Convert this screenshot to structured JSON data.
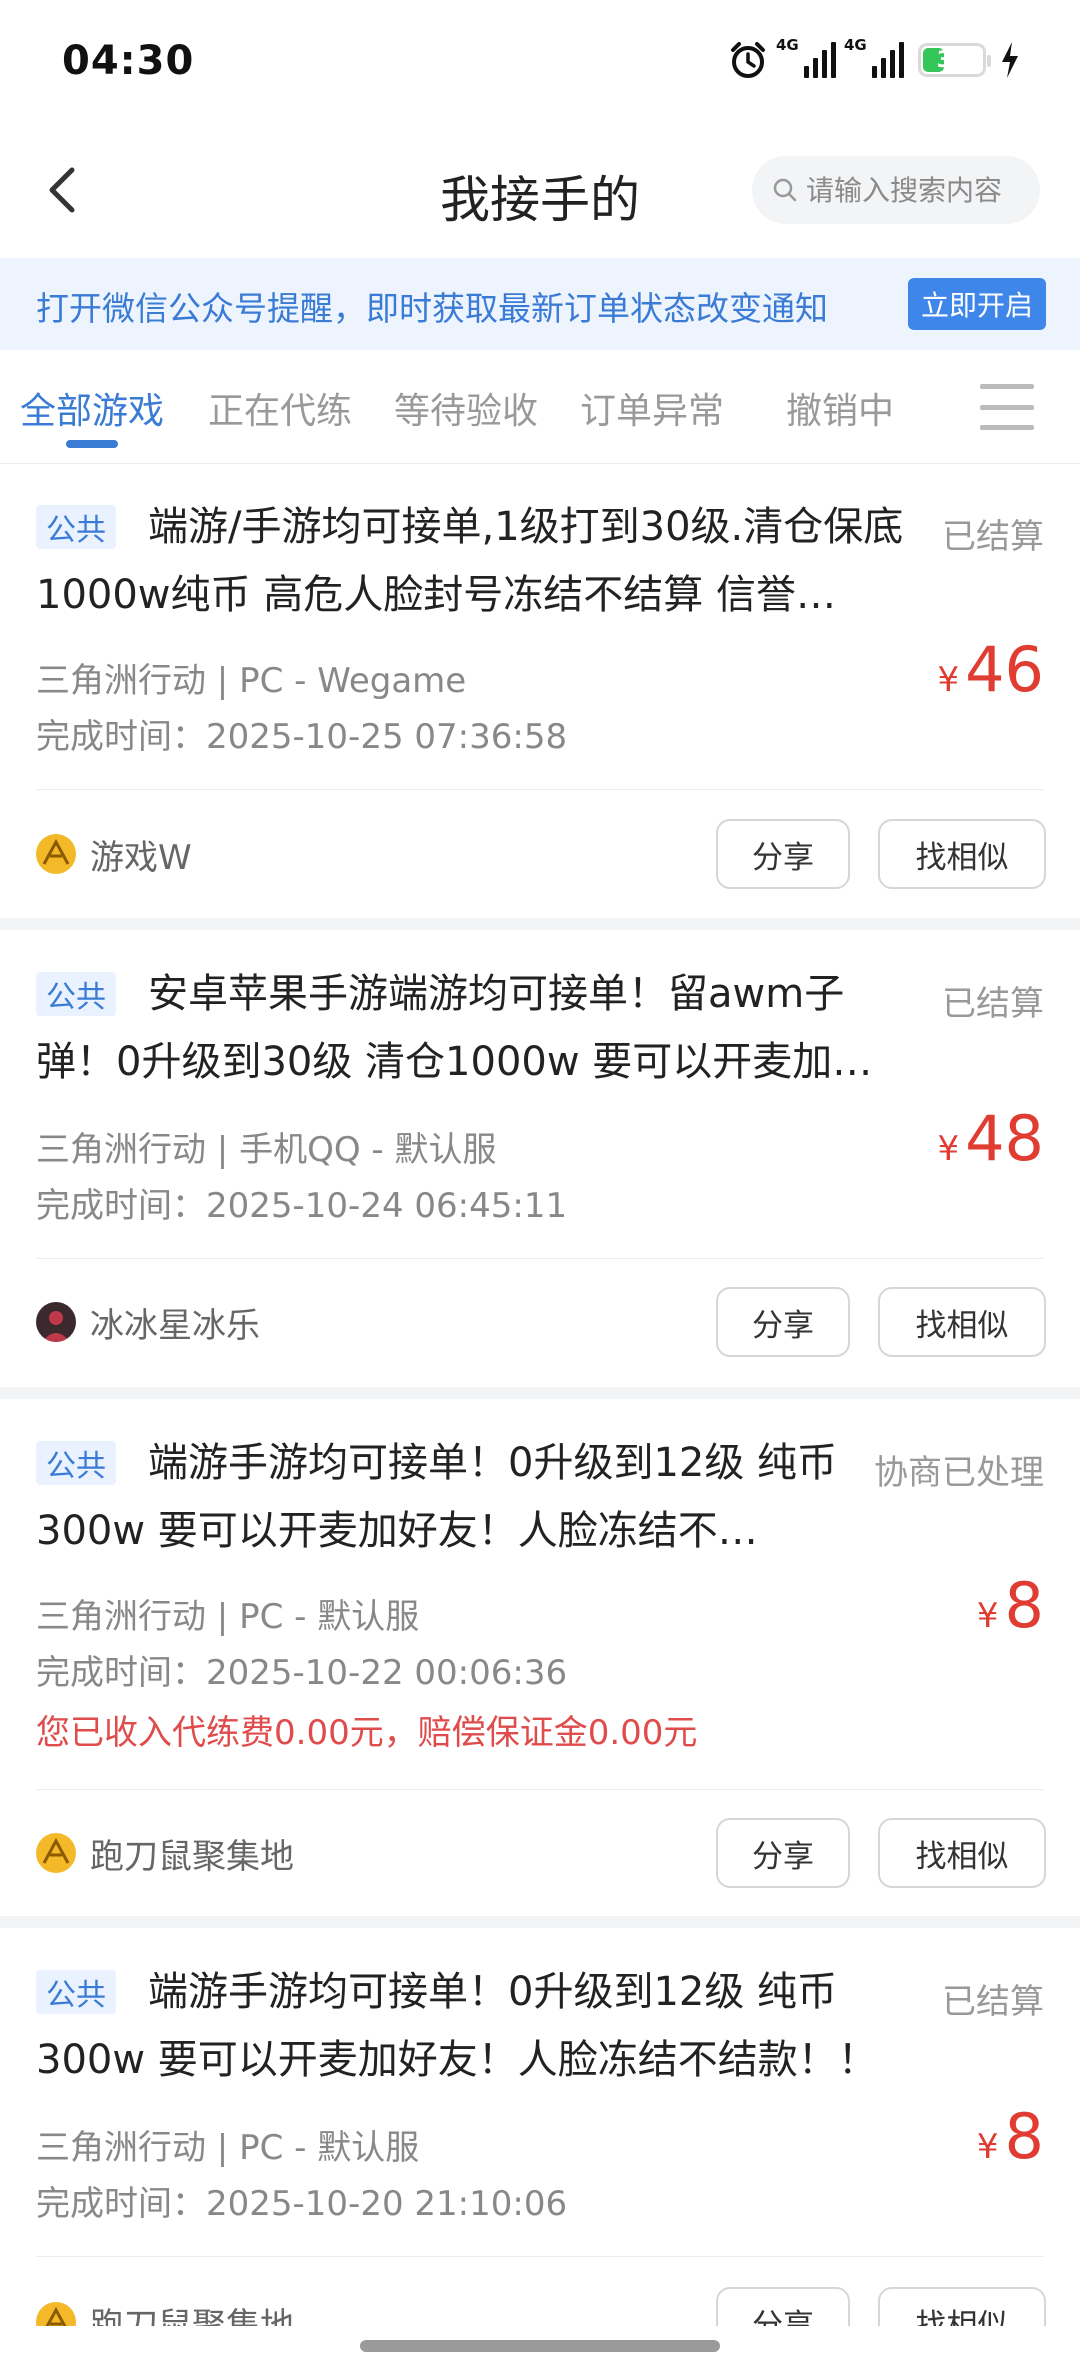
{
  "status_bar": {
    "time": "04:30",
    "signal_1_label": "4G",
    "signal_2_label": "4G",
    "battery": "34",
    "battery_level": 0.34,
    "icons": [
      "alarm-icon",
      "signal-icon",
      "signal-icon",
      "battery-icon",
      "charging-icon"
    ]
  },
  "header": {
    "title": "我接手的",
    "search_placeholder": "请输入搜索内容"
  },
  "banner": {
    "text": "打开微信公众号提醒，即时获取最新订单状态改变通知",
    "button": "立即开启"
  },
  "tabs": [
    {
      "label": "全部游戏",
      "active": true
    },
    {
      "label": "正在代练",
      "active": false
    },
    {
      "label": "等待验收",
      "active": false
    },
    {
      "label": "订单异常",
      "active": false
    },
    {
      "label": "撤销中",
      "active": false
    }
  ],
  "orders": [
    {
      "tag": "公共",
      "title": "端游/手游均可接单,1级打到30级.清仓保底1000w纯币 高危人脸封号冻结不结算 信誉…",
      "status": "已结算",
      "game": "三角洲行动 | PC - Wegame",
      "finish_time": "完成时间：2025-10-25 07:36:58",
      "currency": "¥",
      "price": "46",
      "user": "游戏W",
      "share": "分享",
      "similar": "找相似"
    },
    {
      "tag": "公共",
      "title": "安卓苹果手游端游均可接单！留awm子弹！0升级到30级 清仓1000w 要可以开麦加…",
      "status": "已结算",
      "game": "三角洲行动 | 手机QQ - 默认服",
      "finish_time": "完成时间：2025-10-24 06:45:11",
      "currency": "¥",
      "price": "48",
      "user": "冰冰星冰乐",
      "share": "分享",
      "similar": "找相似"
    },
    {
      "tag": "公共",
      "title": "端游手游均可接单！0升级到12级 纯币300w 要可以开麦加好友！人脸冻结不…",
      "status": "协商已处理",
      "game": "三角洲行动 | PC - 默认服",
      "finish_time": "完成时间：2025-10-22 00:06:36",
      "compensation": "您已收入代练费0.00元，赔偿保证金0.00元",
      "currency": "¥",
      "price": "8",
      "user": "跑刀鼠聚集地",
      "share": "分享",
      "similar": "找相似"
    },
    {
      "tag": "公共",
      "title": "端游手游均可接单！0升级到12级 纯币300w 要可以开麦加好友！人脸冻结不结款！！",
      "status": "已结算",
      "game": "三角洲行动 | PC - 默认服",
      "finish_time": "完成时间：2025-10-20 21:10:06",
      "currency": "¥",
      "price": "8",
      "user": "跑刀鼠聚集地",
      "share": "分享",
      "similar": "找相似"
    }
  ],
  "colors": {
    "accent": "#3a7bd5",
    "price": "#e03c31",
    "banner_bg": "#eef4fd",
    "battery_fill": "#35c659"
  }
}
